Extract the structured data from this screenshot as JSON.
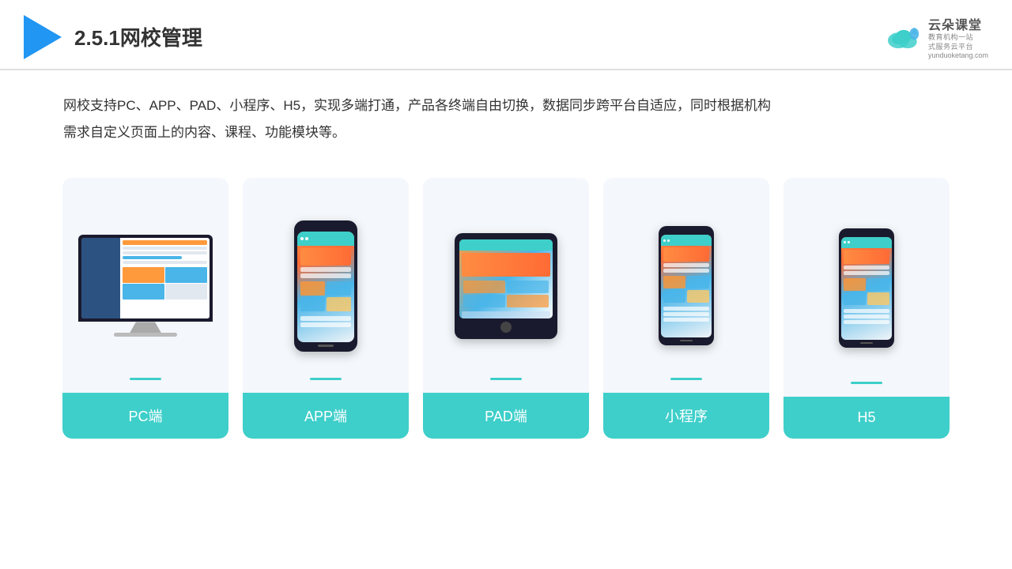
{
  "header": {
    "title": "2.5.1网校管理",
    "logo_brand": "云朵课堂",
    "logo_url": "yunduoketang.com",
    "logo_tagline_1": "教育机构一站",
    "logo_tagline_2": "式服务云平台"
  },
  "description": {
    "text_line1": "网校支持PC、APP、PAD、小程序、H5，实现多端打通，产品各终端自由切换，数据同步跨平台自适应，同时根据机构",
    "text_line2": "需求自定义页面上的内容、课程、功能模块等。"
  },
  "cards": [
    {
      "id": "pc",
      "label": "PC端"
    },
    {
      "id": "app",
      "label": "APP端"
    },
    {
      "id": "pad",
      "label": "PAD端"
    },
    {
      "id": "miniprogram",
      "label": "小程序"
    },
    {
      "id": "h5",
      "label": "H5"
    }
  ],
  "colors": {
    "teal": "#3ecfca",
    "blue_accent": "#2196F3",
    "bg_card": "#f4f7fb",
    "text_dark": "#333333"
  }
}
